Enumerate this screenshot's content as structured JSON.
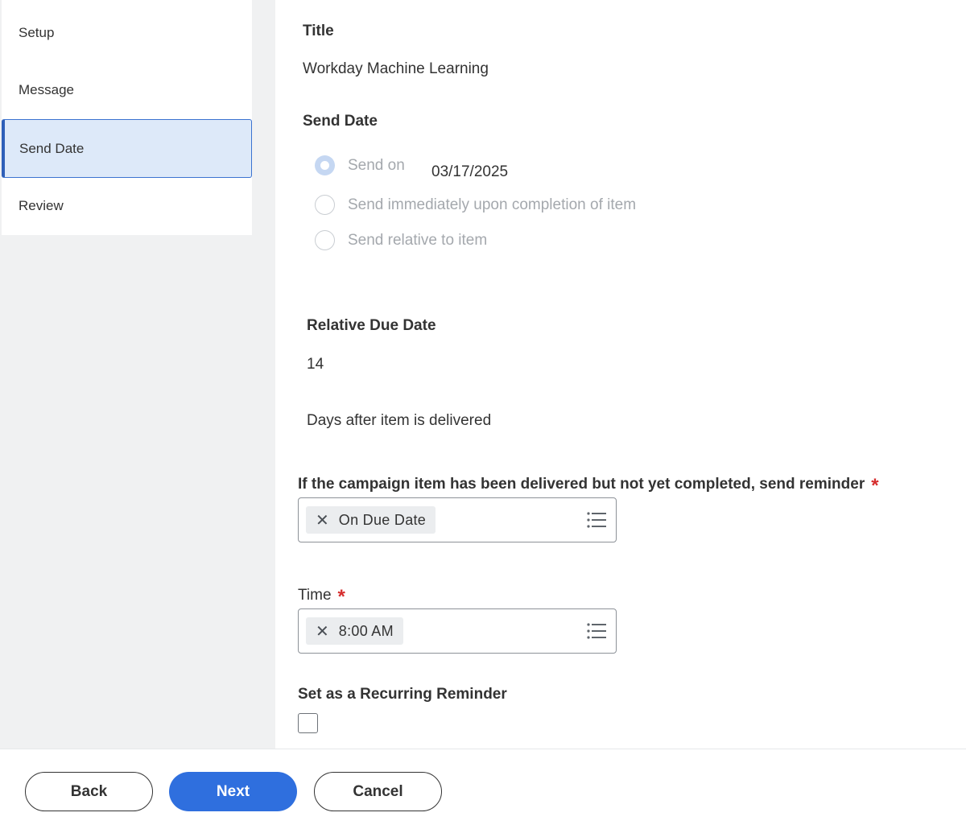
{
  "nav": {
    "items": [
      {
        "label": "Setup"
      },
      {
        "label": "Message"
      },
      {
        "label": "Send Date"
      },
      {
        "label": "Review"
      }
    ],
    "active_index": 2
  },
  "form": {
    "title_label": "Title",
    "title_value": "Workday Machine Learning",
    "send_date_label": "Send Date",
    "send_options": [
      {
        "label": "Send on",
        "checked": true
      },
      {
        "label": "Send immediately upon completion of item",
        "checked": false
      },
      {
        "label": "Send relative to item",
        "checked": false
      }
    ],
    "send_on_date": "03/17/2025",
    "relative_due_date_label": "Relative Due Date",
    "relative_due_date_value": "14",
    "days_after_text": "Days after item is delivered",
    "reminder_label": "If the campaign item has been delivered but not yet completed, send reminder",
    "reminder_value": "On Due Date",
    "time_label": "Time",
    "time_value": "8:00 AM",
    "recurring_label": "Set as a Recurring Reminder",
    "recurring_checked": false,
    "required_marker": "*",
    "remove_glyph": "✕"
  },
  "footer": {
    "back_label": "Back",
    "next_label": "Next",
    "cancel_label": "Cancel"
  },
  "colors": {
    "primary": "#2f6fde",
    "nav_active_bg": "#dde9f9",
    "required": "#d62e2e"
  },
  "icons": {
    "prompt_list": "list-icon",
    "remove": "close-icon"
  }
}
